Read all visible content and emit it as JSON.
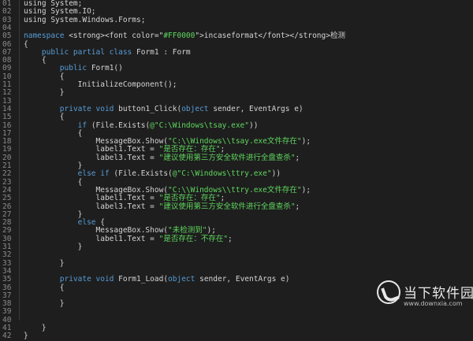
{
  "colors": {
    "background": "#1e1e1e",
    "line_number": "#8a8a8a",
    "plain": "#d4d4d4",
    "keyword": "#569cd6",
    "string": "#5fd75f"
  },
  "code_lines": [
    {
      "num": "01",
      "tokens": [
        {
          "t": "using",
          "c": "plain"
        },
        {
          "t": " System;",
          "c": "plain"
        }
      ]
    },
    {
      "num": "02",
      "tokens": [
        {
          "t": "using",
          "c": "plain"
        },
        {
          "t": " System.IO;",
          "c": "plain"
        }
      ]
    },
    {
      "num": "03",
      "tokens": [
        {
          "t": "using",
          "c": "plain"
        },
        {
          "t": " System.Windows.Forms;",
          "c": "plain"
        }
      ]
    },
    {
      "num": "04",
      "tokens": []
    },
    {
      "num": "05",
      "tokens": [
        {
          "t": "namespace ",
          "c": "kw"
        },
        {
          "t": "<strong><font color=\"",
          "c": "plain"
        },
        {
          "t": "#FF0000",
          "c": "str"
        },
        {
          "t": "\">incaseformat</font></strong>检测",
          "c": "plain"
        }
      ]
    },
    {
      "num": "06",
      "tokens": [
        {
          "t": "{",
          "c": "plain"
        }
      ]
    },
    {
      "num": "07",
      "tokens": [
        {
          "t": "    ",
          "c": "plain"
        },
        {
          "t": "public partial class ",
          "c": "kw"
        },
        {
          "t": "Form1 : Form",
          "c": "plain"
        }
      ]
    },
    {
      "num": "08",
      "tokens": [
        {
          "t": "    {",
          "c": "plain"
        }
      ]
    },
    {
      "num": "09",
      "tokens": [
        {
          "t": "        ",
          "c": "plain"
        },
        {
          "t": "public ",
          "c": "kw"
        },
        {
          "t": "Form1()",
          "c": "plain"
        }
      ]
    },
    {
      "num": "10",
      "tokens": [
        {
          "t": "        {",
          "c": "plain"
        }
      ]
    },
    {
      "num": "11",
      "tokens": [
        {
          "t": "            InitializeComponent();",
          "c": "plain"
        }
      ]
    },
    {
      "num": "12",
      "tokens": [
        {
          "t": "        }",
          "c": "plain"
        }
      ]
    },
    {
      "num": "13",
      "tokens": []
    },
    {
      "num": "14",
      "tokens": [
        {
          "t": "        ",
          "c": "plain"
        },
        {
          "t": "private void ",
          "c": "kw"
        },
        {
          "t": "button1_Click(",
          "c": "plain"
        },
        {
          "t": "object ",
          "c": "kw"
        },
        {
          "t": "sender, EventArgs e)",
          "c": "plain"
        }
      ]
    },
    {
      "num": "15",
      "tokens": [
        {
          "t": "        {",
          "c": "plain"
        }
      ]
    },
    {
      "num": "16",
      "tokens": [
        {
          "t": "            ",
          "c": "plain"
        },
        {
          "t": "if ",
          "c": "kw"
        },
        {
          "t": "(File.Exists(",
          "c": "plain"
        },
        {
          "t": "@\"C:\\Windows\\tsay.exe\"",
          "c": "str"
        },
        {
          "t": "))",
          "c": "plain"
        }
      ]
    },
    {
      "num": "17",
      "tokens": [
        {
          "t": "            {",
          "c": "plain"
        }
      ]
    },
    {
      "num": "18",
      "tokens": [
        {
          "t": "                MessageBox.Show(",
          "c": "plain"
        },
        {
          "t": "\"C:\\\\Windows\\\\tsay.exe文件存在\"",
          "c": "str"
        },
        {
          "t": ");",
          "c": "plain"
        }
      ]
    },
    {
      "num": "19",
      "tokens": [
        {
          "t": "                label1.Text = ",
          "c": "plain"
        },
        {
          "t": "\"是否存在：存在\"",
          "c": "str"
        },
        {
          "t": ";",
          "c": "plain"
        }
      ]
    },
    {
      "num": "20",
      "tokens": [
        {
          "t": "                label3.Text = ",
          "c": "plain"
        },
        {
          "t": "\"建议使用第三方安全软件进行全盘查杀\"",
          "c": "str"
        },
        {
          "t": ";",
          "c": "plain"
        }
      ]
    },
    {
      "num": "21",
      "tokens": [
        {
          "t": "            }",
          "c": "plain"
        }
      ]
    },
    {
      "num": "22",
      "tokens": [
        {
          "t": "            ",
          "c": "plain"
        },
        {
          "t": "else if ",
          "c": "kw"
        },
        {
          "t": "(File.Exists(",
          "c": "plain"
        },
        {
          "t": "@\"C:\\Windows\\ttry.exe\"",
          "c": "str"
        },
        {
          "t": "))",
          "c": "plain"
        }
      ]
    },
    {
      "num": "23",
      "tokens": [
        {
          "t": "            {",
          "c": "plain"
        }
      ]
    },
    {
      "num": "24",
      "tokens": [
        {
          "t": "                MessageBox.Show(",
          "c": "plain"
        },
        {
          "t": "\"C:\\\\Windows\\\\ttry.exe文件存在\"",
          "c": "str"
        },
        {
          "t": ");",
          "c": "plain"
        }
      ]
    },
    {
      "num": "25",
      "tokens": [
        {
          "t": "                label1.Text = ",
          "c": "plain"
        },
        {
          "t": "\"是否存在：存在\"",
          "c": "str"
        },
        {
          "t": ";",
          "c": "plain"
        }
      ]
    },
    {
      "num": "26",
      "tokens": [
        {
          "t": "                label3.Text = ",
          "c": "plain"
        },
        {
          "t": "\"建议使用第三方安全软件进行全盘查杀\"",
          "c": "str"
        },
        {
          "t": ";",
          "c": "plain"
        }
      ]
    },
    {
      "num": "27",
      "tokens": [
        {
          "t": "            }",
          "c": "plain"
        }
      ]
    },
    {
      "num": "28",
      "tokens": [
        {
          "t": "            ",
          "c": "plain"
        },
        {
          "t": "else ",
          "c": "kw"
        },
        {
          "t": "{",
          "c": "plain"
        }
      ]
    },
    {
      "num": "29",
      "tokens": [
        {
          "t": "                MessageBox.Show(",
          "c": "plain"
        },
        {
          "t": "\"未检测到\"",
          "c": "str"
        },
        {
          "t": ");",
          "c": "plain"
        }
      ]
    },
    {
      "num": "30",
      "tokens": [
        {
          "t": "                label1.Text = ",
          "c": "plain"
        },
        {
          "t": "\"是否存在：不存在\"",
          "c": "str"
        },
        {
          "t": ";",
          "c": "plain"
        }
      ]
    },
    {
      "num": "31",
      "tokens": [
        {
          "t": "            }",
          "c": "plain"
        }
      ]
    },
    {
      "num": "32",
      "tokens": []
    },
    {
      "num": "33",
      "tokens": [
        {
          "t": "        }",
          "c": "plain"
        }
      ]
    },
    {
      "num": "34",
      "tokens": []
    },
    {
      "num": "35",
      "tokens": [
        {
          "t": "        ",
          "c": "plain"
        },
        {
          "t": "private void ",
          "c": "kw"
        },
        {
          "t": "Form1_Load(",
          "c": "plain"
        },
        {
          "t": "object ",
          "c": "kw"
        },
        {
          "t": "sender, EventArgs e)",
          "c": "plain"
        }
      ]
    },
    {
      "num": "36",
      "tokens": [
        {
          "t": "        {",
          "c": "plain"
        }
      ]
    },
    {
      "num": "37",
      "tokens": []
    },
    {
      "num": "38",
      "tokens": [
        {
          "t": "        }",
          "c": "plain"
        }
      ]
    },
    {
      "num": "39",
      "tokens": []
    },
    {
      "num": "40",
      "tokens": []
    },
    {
      "num": "41",
      "tokens": [
        {
          "t": "    }",
          "c": "plain"
        }
      ]
    },
    {
      "num": "42",
      "tokens": [
        {
          "t": "}",
          "c": "plain"
        }
      ]
    }
  ],
  "watermark": {
    "title": "当下软件园",
    "url": "www.downxia.com",
    "icon": "downxia-logo-icon"
  }
}
